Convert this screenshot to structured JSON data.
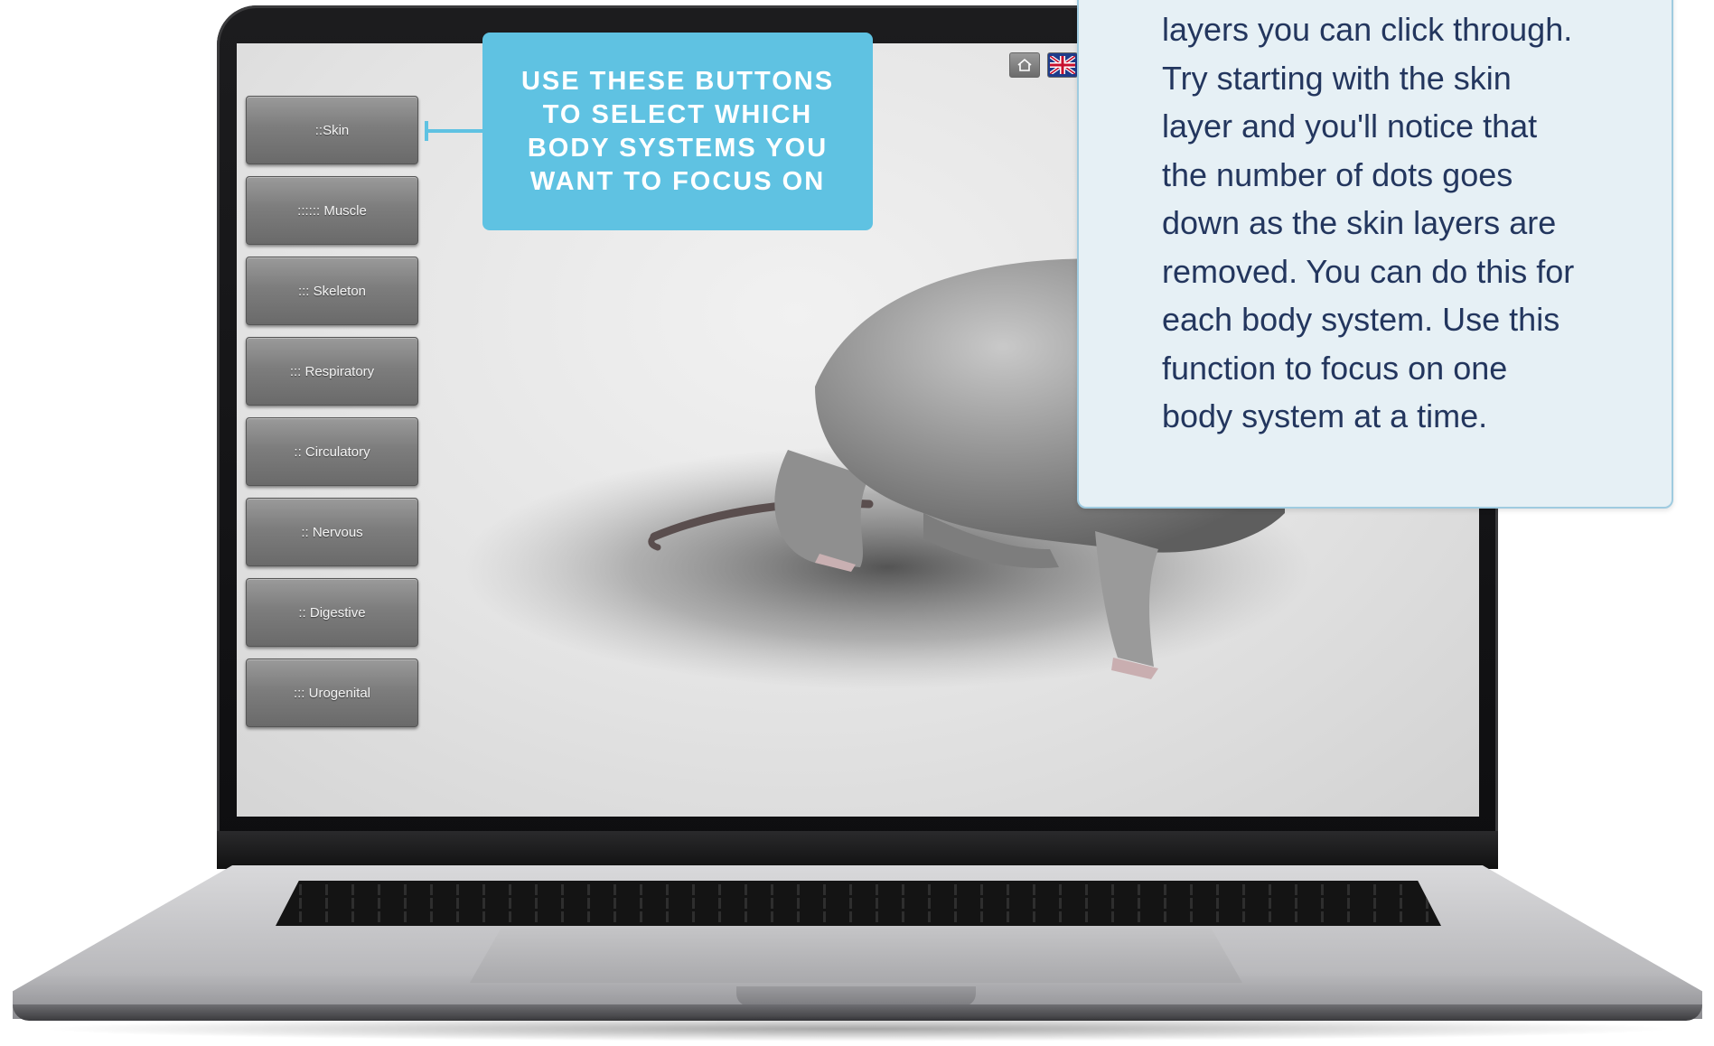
{
  "app": {
    "system_buttons": [
      {
        "label": "::Skin"
      },
      {
        "label": ":::::: Muscle"
      },
      {
        "label": "::: Skeleton"
      },
      {
        "label": "::: Respiratory"
      },
      {
        "label": ":: Circulatory"
      },
      {
        "label": ":: Nervous"
      },
      {
        "label": ":: Digestive"
      },
      {
        "label": "::: Urogenital"
      }
    ],
    "top_icons": [
      "home-icon",
      "uk-flag-icon"
    ]
  },
  "callout_buttons": {
    "lines": [
      "USE THESE BUTTONS",
      "TO SELECT WHICH",
      "BODY SYSTEMS YOU",
      "WANT TO FOCUS ON"
    ]
  },
  "callout_info": {
    "lines": [
      "layers you can click through.",
      "Try starting with the skin",
      "layer and you'll notice that",
      "the number of dots goes",
      "down as the skin layers are",
      "removed. You can do this for",
      "each body system. Use this",
      "function to focus on one",
      "body system at a time."
    ]
  },
  "colors": {
    "callout_blue": "#5fc2e2",
    "info_text": "#23365e",
    "info_background": "#e6f0f5"
  }
}
